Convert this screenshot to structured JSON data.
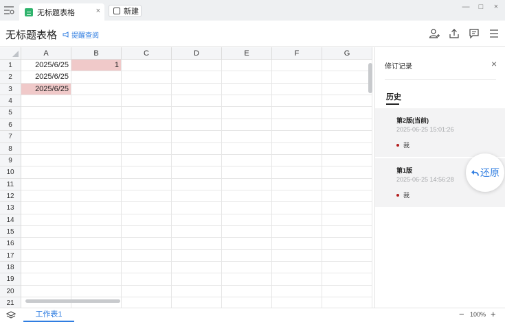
{
  "titlebar": {
    "menu_icon": "menu-icon",
    "tabs": [
      {
        "label": "无标题表格",
        "icon": "spreadsheet-icon",
        "close": "×"
      },
      {
        "label": "新建",
        "icon": "new-doc-icon"
      }
    ],
    "window_controls": {
      "minimize": "—",
      "maximize": "□",
      "close": "×"
    }
  },
  "header": {
    "title": "无标题表格",
    "remind_label": "提醒查阅",
    "icons": [
      "add-user-icon",
      "share-icon",
      "comment-icon",
      "more-menu-icon"
    ]
  },
  "grid": {
    "columns": [
      "A",
      "B",
      "C",
      "D",
      "E",
      "F",
      "G"
    ],
    "rows": [
      "1",
      "2",
      "3",
      "4",
      "5",
      "6",
      "7",
      "8",
      "9",
      "10",
      "11",
      "12",
      "13",
      "14",
      "15",
      "16",
      "17",
      "18",
      "19",
      "20",
      "21"
    ],
    "cells": {
      "A1": "2025/6/25",
      "B1": "1",
      "A2": "2025/6/25",
      "A3": "2025/6/25"
    },
    "highlight_color": "#f0c9c9"
  },
  "revision_panel": {
    "title": "修订记录",
    "close": "×",
    "tab": "历史",
    "versions": [
      {
        "title": "第2版(当前)",
        "time": "2025-06-25 15:01:26",
        "author": "我"
      },
      {
        "title": "第1版",
        "time": "2025-06-25 14:56:28",
        "author": "我"
      }
    ],
    "restore_label": "还原",
    "restore_icon": "undo-icon"
  },
  "bottombar": {
    "layers_icon": "layers-icon",
    "sheet_tab": "工作表1",
    "zoom": "100%",
    "zoom_minus": "−",
    "zoom_plus": "+"
  },
  "colors": {
    "accent": "#2f7de1",
    "sheet_green": "#2fb36c",
    "author_dot": "#b31d1d"
  }
}
